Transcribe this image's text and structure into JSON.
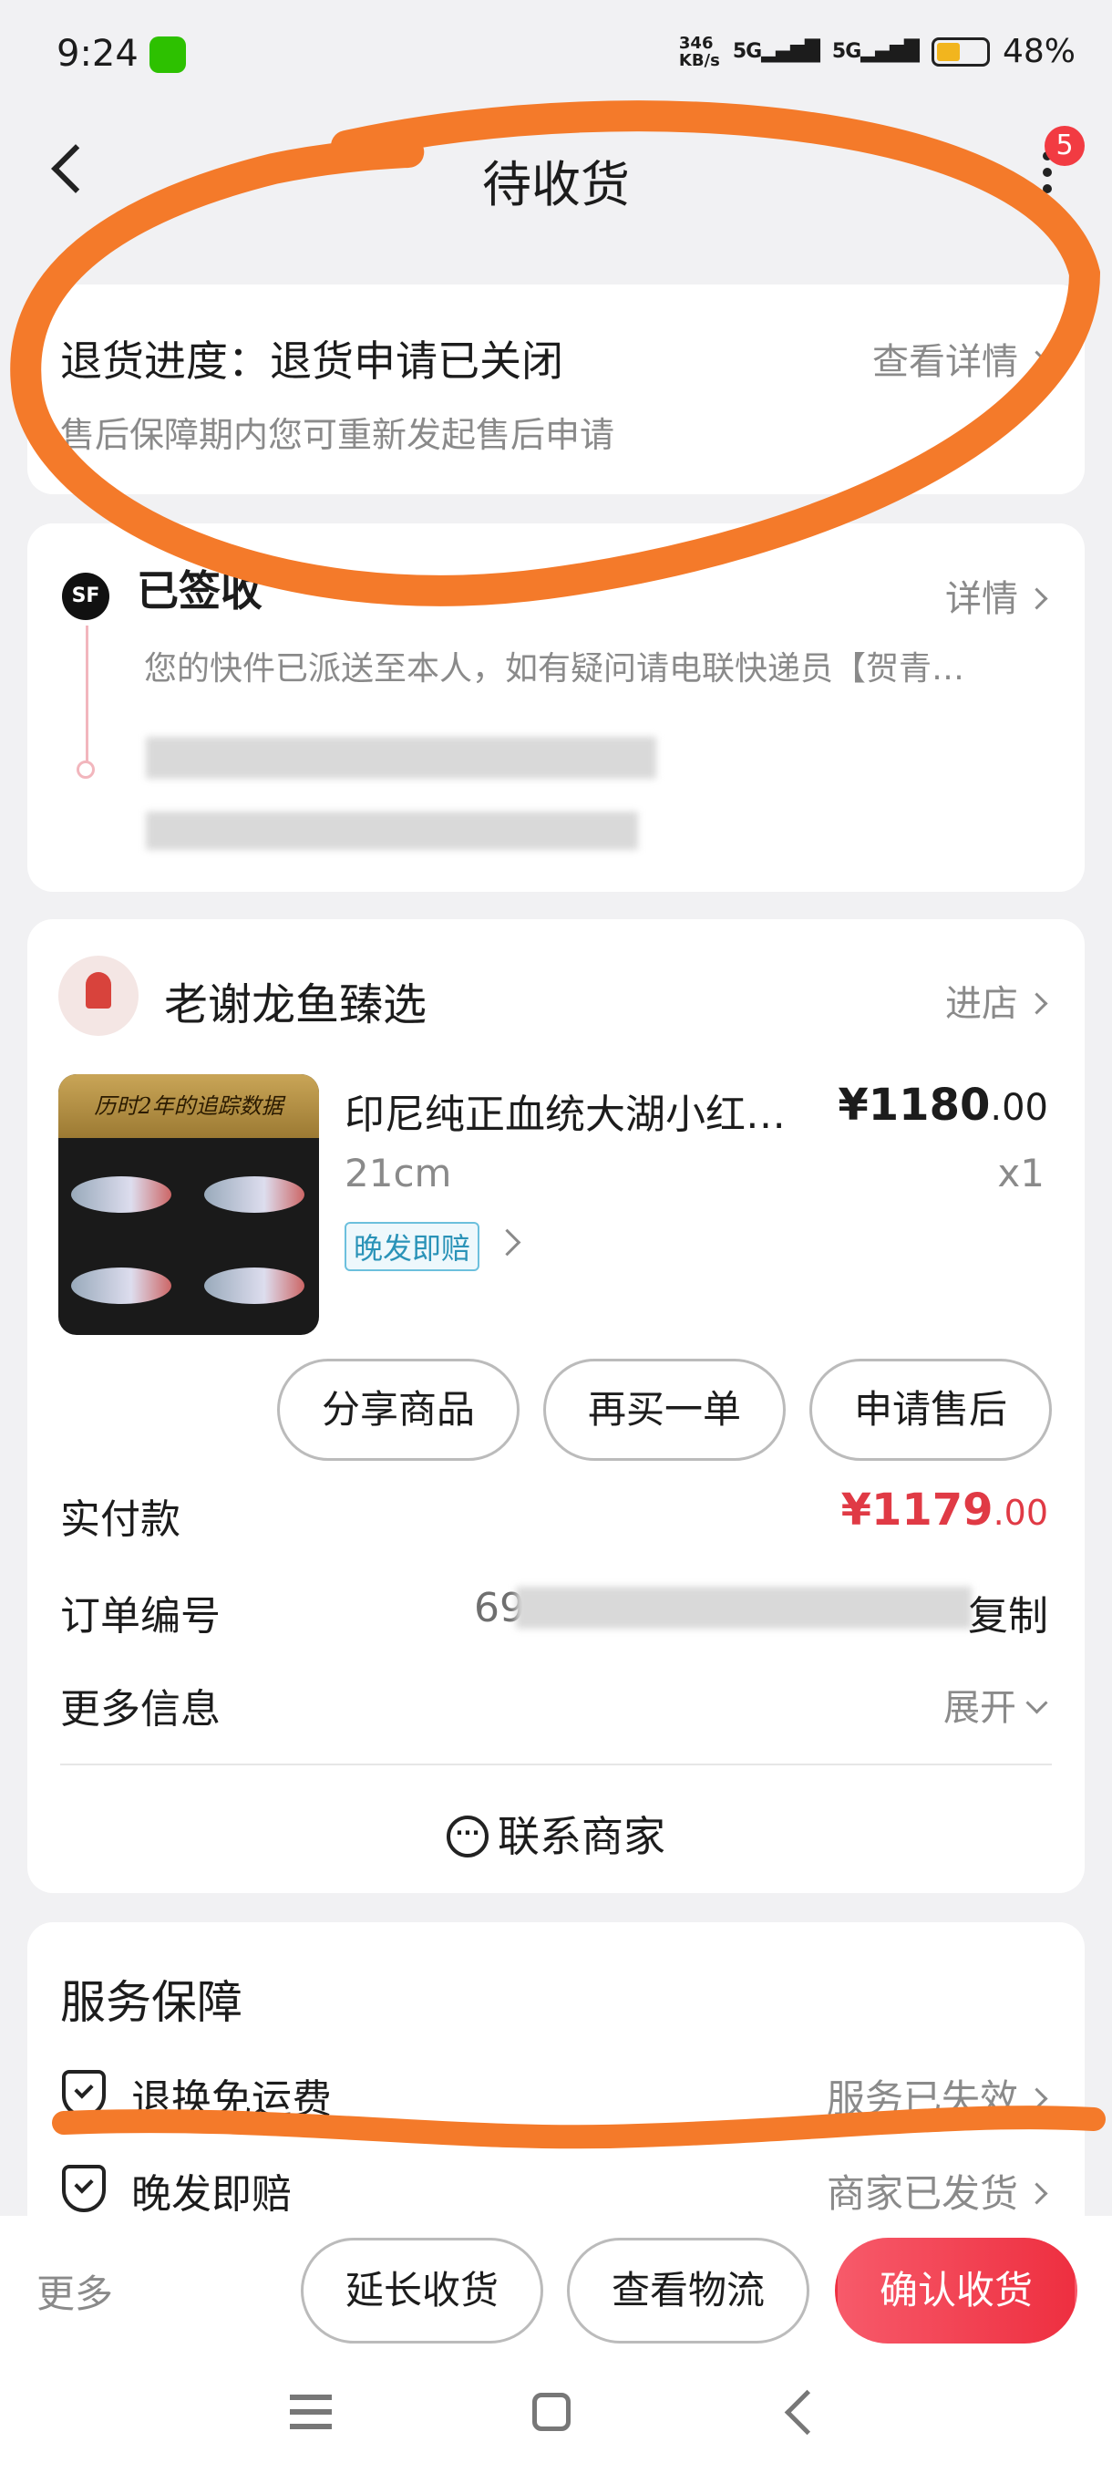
{
  "status_bar": {
    "time": "9:24",
    "network_speed_value": "346",
    "network_speed_unit": "KB/s",
    "signal_1": "5G",
    "signal_2": "5G",
    "battery_percent": "48%",
    "battery_level": 0.48
  },
  "header": {
    "title": "待收货",
    "badge_count": "5"
  },
  "refund": {
    "title": "退货进度：退货申请已关闭",
    "link": "查看详情",
    "desc": "售后保障期内您可重新发起售后申请"
  },
  "logistics": {
    "carrier_icon": "SF",
    "status": "已签收",
    "link": "详情",
    "desc": "您的快件已派送至本人，如有疑问请电联快递员【贺青…"
  },
  "order": {
    "shop_name": "老谢龙鱼臻选",
    "shop_link": "进店",
    "thumb_caption": "历时2年的追踪数据",
    "product_name": "印尼纯正血统大湖小红…",
    "price_main": "¥1180",
    "price_decimal": ".00",
    "spec": "21cm",
    "qty": "x1",
    "tag": "晚发即赔",
    "buttons": [
      "分享商品",
      "再买一单",
      "申请售后"
    ],
    "paid_label": "实付款",
    "paid_main": "¥1179",
    "paid_decimal": ".00",
    "order_no_label": "订单编号",
    "order_no_prefix": "69",
    "copy": "复制",
    "more_label": "更多信息",
    "expand": "展开",
    "contact": "联系商家"
  },
  "service": {
    "title": "服务保障",
    "items": [
      {
        "name": "退换免运费",
        "status": "服务已失效"
      },
      {
        "name": "晚发即赔",
        "status": "商家已发货"
      }
    ]
  },
  "bottom": {
    "more": "更多",
    "extend": "延长收货",
    "logistics": "查看物流",
    "confirm": "确认收货"
  },
  "colors": {
    "accent": "#e03a45",
    "marker": "#f47a2a"
  }
}
